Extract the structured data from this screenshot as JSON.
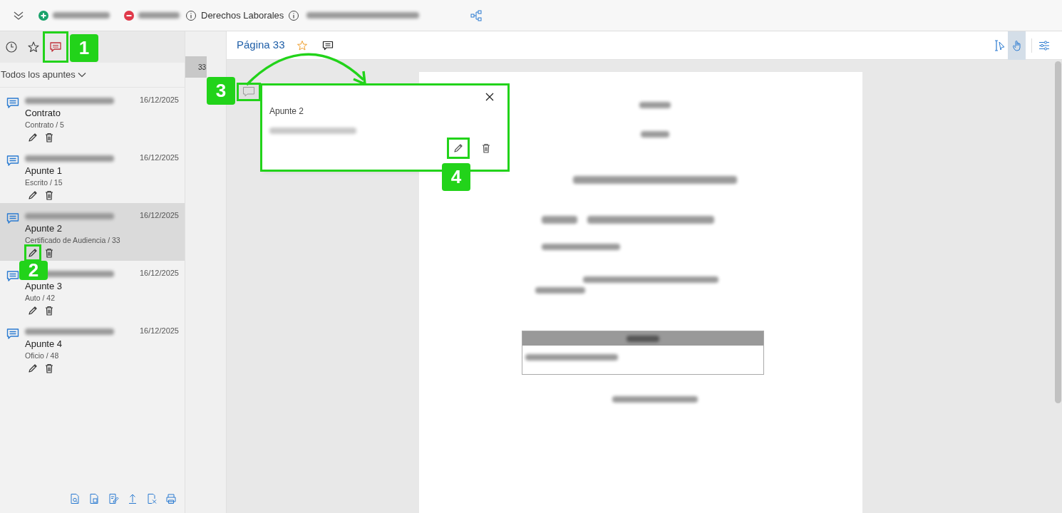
{
  "toolbar": {
    "parties": [
      {
        "kind": "plus"
      },
      {
        "kind": "minus"
      }
    ],
    "subject": "Derechos Laborales"
  },
  "sidebar": {
    "tabs": [
      {
        "kind": "history",
        "selected": false
      },
      {
        "kind": "favorites",
        "selected": false
      },
      {
        "kind": "notes",
        "selected": true
      }
    ],
    "filter": "Todos los apuntes",
    "notes": [
      {
        "title": "Contrato",
        "date": "16/12/2025",
        "source": "Contrato / 5",
        "selected": false
      },
      {
        "title": "Apunte 1",
        "date": "16/12/2025",
        "source": "Escrito / 15",
        "selected": false
      },
      {
        "title": "Apunte 2",
        "date": "16/12/2025",
        "source": "Certificado de Audiencia / 33",
        "selected": true
      },
      {
        "title": "Apunte 3",
        "date": "16/12/2025",
        "source": "Auto / 42",
        "selected": false
      },
      {
        "title": "Apunte 4",
        "date": "16/12/2025",
        "source": "Oficio / 48",
        "selected": false
      }
    ]
  },
  "page_markers": [
    {
      "label": "33",
      "selected": true
    }
  ],
  "viewer": {
    "page_label": "Página 33",
    "tools": [
      {
        "kind": "select",
        "selected": false
      },
      {
        "kind": "pan",
        "selected": true
      }
    ]
  },
  "popup": {
    "title": "Apunte 2"
  },
  "annotations": [
    {
      "label": "1"
    },
    {
      "label": "2"
    },
    {
      "label": "3"
    },
    {
      "label": "4"
    }
  ]
}
